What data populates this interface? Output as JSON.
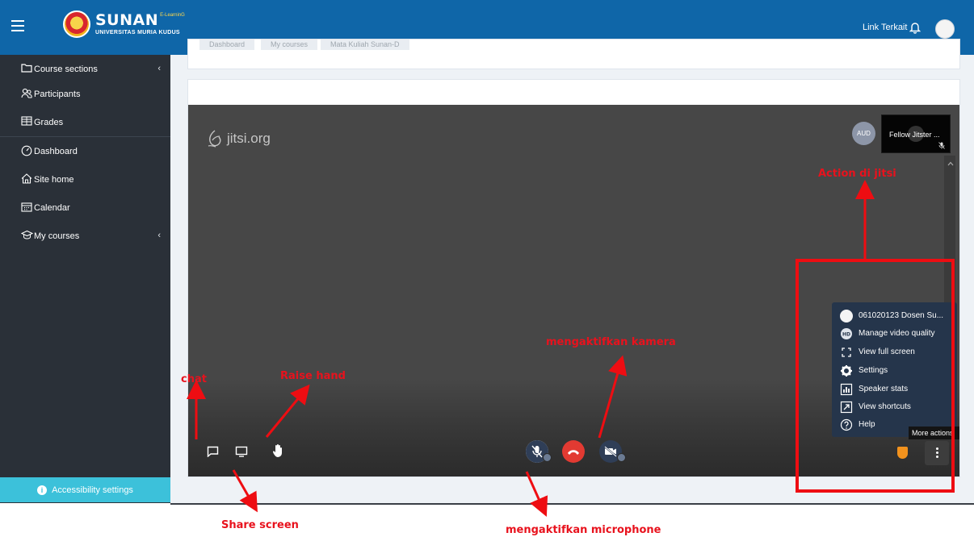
{
  "header": {
    "brand": "SUNAN",
    "brand_tag": "E-LearninG",
    "brand_sub": "UNIVERSITAS MURIA KUDUS",
    "link_label": "Link Terkait"
  },
  "sidebar": {
    "items": [
      {
        "label": "Course sections",
        "icon": "folder-icon",
        "has_chevron": true
      },
      {
        "label": "Participants",
        "icon": "users-icon",
        "has_chevron": false
      },
      {
        "label": "Grades",
        "icon": "grades-table-icon",
        "has_chevron": false
      },
      {
        "label": "Dashboard",
        "icon": "gauge-icon",
        "has_chevron": false
      },
      {
        "label": "Site home",
        "icon": "home-icon",
        "has_chevron": false
      },
      {
        "label": "Calendar",
        "icon": "calendar-icon",
        "has_chevron": false
      },
      {
        "label": "My courses",
        "icon": "graduation-cap-icon",
        "has_chevron": true
      }
    ],
    "chevron": "‹",
    "accessibility_label": "Accessibility settings"
  },
  "breadcrumb": {
    "items": [
      "Dashboard",
      "My courses",
      "Mata Kuliah Sunan-D"
    ]
  },
  "jitsi": {
    "brand": "jitsi.org",
    "remote_avatar_initials": "AUD",
    "thumbnail_name": "Fellow Jitster ...",
    "tooltip": "More actions",
    "menu": [
      {
        "label": "061020123 Dosen Su...",
        "icon": "user-avatar-icon"
      },
      {
        "label": "Manage video quality",
        "icon": "hd-badge-icon"
      },
      {
        "label": "View full screen",
        "icon": "fullscreen-icon"
      },
      {
        "label": "Settings",
        "icon": "gear-icon"
      },
      {
        "label": "Speaker stats",
        "icon": "bar-chart-icon"
      },
      {
        "label": "View shortcuts",
        "icon": "external-arrow-icon"
      },
      {
        "label": "Help",
        "icon": "help-circle-icon"
      }
    ]
  },
  "annotations": {
    "chat": "chat",
    "raise_hand": "Raise hand",
    "share_screen": "Share screen",
    "camera": "mengaktifkan kamera",
    "microphone": "mengaktifkan microphone",
    "actions": "Action di jitsi",
    "color": "#e8121d"
  }
}
